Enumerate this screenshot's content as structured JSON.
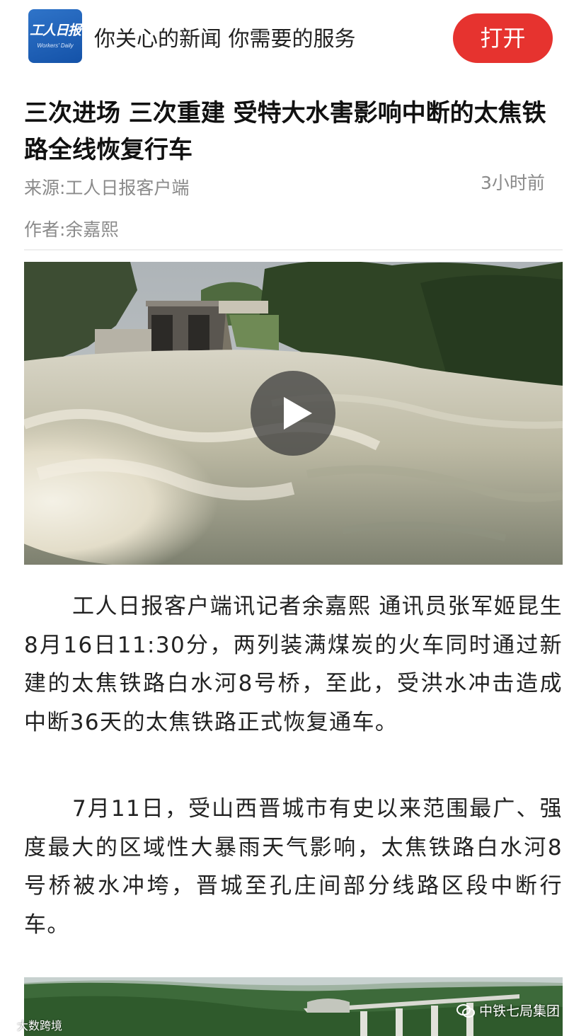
{
  "banner": {
    "logo_text": "工人日报",
    "logo_sub": "Workers' Daily",
    "slogan": "你关心的新闻 你需要的服务",
    "open_label": "打开"
  },
  "article": {
    "title": "三次进场 三次重建 受特大水害影响中断的太焦铁路全线恢复行车",
    "source": "来源:工人日报客户端",
    "time": "3小时前",
    "author": "作者:余嘉熙",
    "paragraphs": [
      "工人日报客户端讯记者余嘉熙 通讯员张军姬昆生 8月16日11:30分，两列装满煤炭的火车同时通过新建的太焦铁路白水河8号桥，至此，受洪水冲击造成中断36天的太焦铁路正式恢复通车。",
      "7月11日，受山西晋城市有史以来范围最广、强度最大的区域性大暴雨天气影响，太焦铁路白水河8号桥被水冲垮，晋城至孔庄间部分线路区段中断行车。"
    ]
  },
  "video": {
    "icon": "play-icon"
  },
  "watermarks": {
    "left": "大数跨境",
    "right": "中铁七局集团"
  },
  "colors": {
    "accent": "#e6332f",
    "logo_blue": "#1f5fb8",
    "meta_gray": "#8a8a8a"
  }
}
